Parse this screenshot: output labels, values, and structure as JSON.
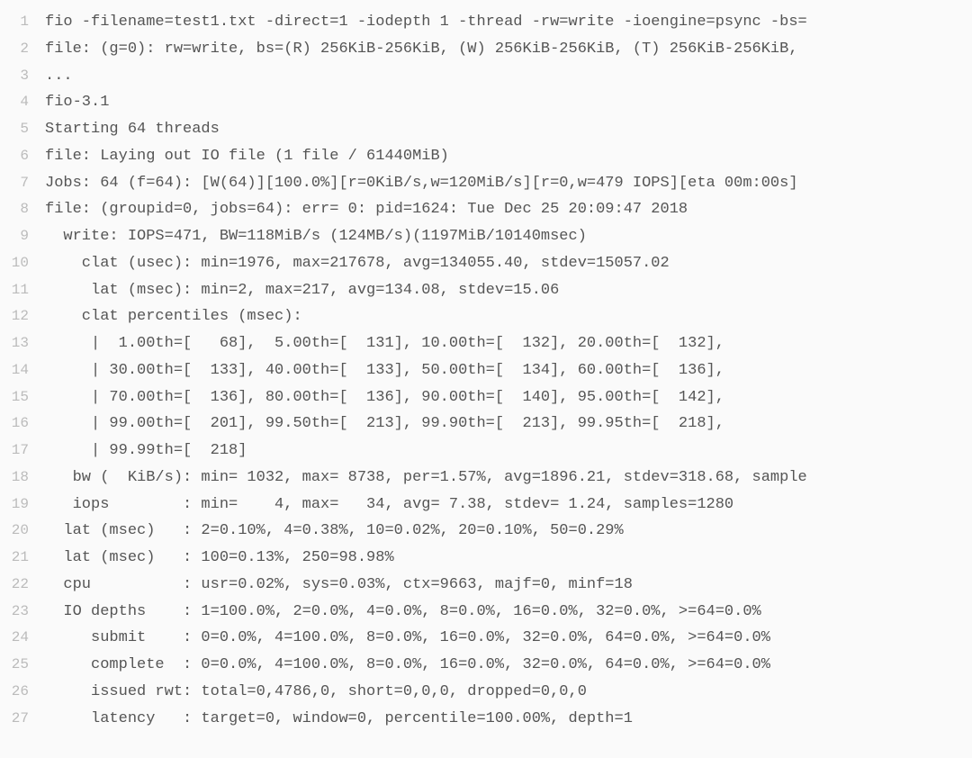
{
  "lines": [
    {
      "n": 1,
      "text": "fio -filename=test1.txt -direct=1 -iodepth 1 -thread -rw=write -ioengine=psync -bs="
    },
    {
      "n": 2,
      "text": "file: (g=0): rw=write, bs=(R) 256KiB-256KiB, (W) 256KiB-256KiB, (T) 256KiB-256KiB,"
    },
    {
      "n": 3,
      "text": "..."
    },
    {
      "n": 4,
      "text": "fio-3.1"
    },
    {
      "n": 5,
      "text": "Starting 64 threads"
    },
    {
      "n": 6,
      "text": "file: Laying out IO file (1 file / 61440MiB)"
    },
    {
      "n": 7,
      "text": "Jobs: 64 (f=64): [W(64)][100.0%][r=0KiB/s,w=120MiB/s][r=0,w=479 IOPS][eta 00m:00s]"
    },
    {
      "n": 8,
      "text": "file: (groupid=0, jobs=64): err= 0: pid=1624: Tue Dec 25 20:09:47 2018"
    },
    {
      "n": 9,
      "text": "  write: IOPS=471, BW=118MiB/s (124MB/s)(1197MiB/10140msec)"
    },
    {
      "n": 10,
      "text": "    clat (usec): min=1976, max=217678, avg=134055.40, stdev=15057.02"
    },
    {
      "n": 11,
      "text": "     lat (msec): min=2, max=217, avg=134.08, stdev=15.06"
    },
    {
      "n": 12,
      "text": "    clat percentiles (msec):"
    },
    {
      "n": 13,
      "text": "     |  1.00th=[   68],  5.00th=[  131], 10.00th=[  132], 20.00th=[  132],"
    },
    {
      "n": 14,
      "text": "     | 30.00th=[  133], 40.00th=[  133], 50.00th=[  134], 60.00th=[  136],"
    },
    {
      "n": 15,
      "text": "     | 70.00th=[  136], 80.00th=[  136], 90.00th=[  140], 95.00th=[  142],"
    },
    {
      "n": 16,
      "text": "     | 99.00th=[  201], 99.50th=[  213], 99.90th=[  213], 99.95th=[  218],"
    },
    {
      "n": 17,
      "text": "     | 99.99th=[  218]"
    },
    {
      "n": 18,
      "text": "   bw (  KiB/s): min= 1032, max= 8738, per=1.57%, avg=1896.21, stdev=318.68, sample"
    },
    {
      "n": 19,
      "text": "   iops        : min=    4, max=   34, avg= 7.38, stdev= 1.24, samples=1280"
    },
    {
      "n": 20,
      "text": "  lat (msec)   : 2=0.10%, 4=0.38%, 10=0.02%, 20=0.10%, 50=0.29%"
    },
    {
      "n": 21,
      "text": "  lat (msec)   : 100=0.13%, 250=98.98%"
    },
    {
      "n": 22,
      "text": "  cpu          : usr=0.02%, sys=0.03%, ctx=9663, majf=0, minf=18"
    },
    {
      "n": 23,
      "text": "  IO depths    : 1=100.0%, 2=0.0%, 4=0.0%, 8=0.0%, 16=0.0%, 32=0.0%, >=64=0.0%"
    },
    {
      "n": 24,
      "text": "     submit    : 0=0.0%, 4=100.0%, 8=0.0%, 16=0.0%, 32=0.0%, 64=0.0%, >=64=0.0%"
    },
    {
      "n": 25,
      "text": "     complete  : 0=0.0%, 4=100.0%, 8=0.0%, 16=0.0%, 32=0.0%, 64=0.0%, >=64=0.0%"
    },
    {
      "n": 26,
      "text": "     issued rwt: total=0,4786,0, short=0,0,0, dropped=0,0,0"
    },
    {
      "n": 27,
      "text": "     latency   : target=0, window=0, percentile=100.00%, depth=1"
    }
  ]
}
